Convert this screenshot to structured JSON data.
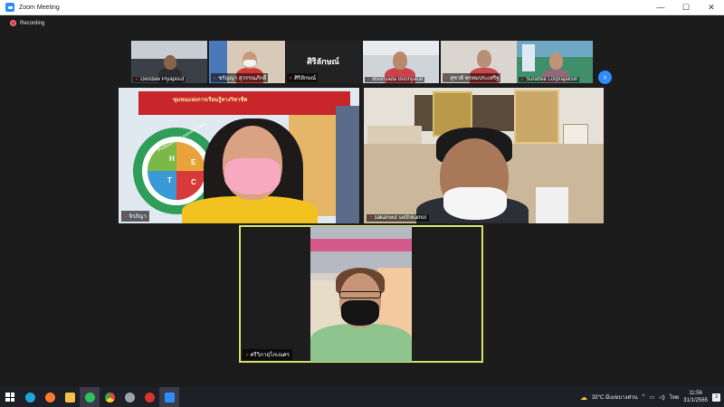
{
  "window": {
    "title": "Zoom Meeting",
    "minimize": "—",
    "maximize": "☐",
    "close": "✕"
  },
  "recording": {
    "label": "Recording"
  },
  "strip": {
    "participants": [
      {
        "name": "Dendaw Piyapisut"
      },
      {
        "name": "ชรัญญา สุวรรณภักดี"
      },
      {
        "name": "ศิริลักษณ์",
        "display_name": "ศิริลักษณ์"
      },
      {
        "name": "Boonyada Boonyarat"
      },
      {
        "name": "สุชาติ พรหมประเสริฐ"
      },
      {
        "name": "Surattee Lorprajaksiri"
      }
    ],
    "next_icon": "›"
  },
  "gallery": {
    "top_left": {
      "name": "จิรภิญา",
      "banner_title": "ชุมชนแห่งการเรียนรู้ทางวิชาชีพ",
      "wheel_letters": [
        "H",
        "E",
        "T",
        "C"
      ],
      "wheel_text": "Professional Learning Com"
    },
    "top_right": {
      "name": "sakanwut setthikamol"
    },
    "bottom": {
      "name": "ศรีวิภาสุโภเณศร"
    }
  },
  "taskbar": {
    "weather": "33°C มีเมฆบางส่วน",
    "language": "ไทย",
    "time": "11:56",
    "date": "31/1/2565",
    "notifications": "3"
  },
  "colors": {
    "accent": "#2d8cff",
    "active_speaker": "#d6e265",
    "recording": "#e23b3b"
  }
}
